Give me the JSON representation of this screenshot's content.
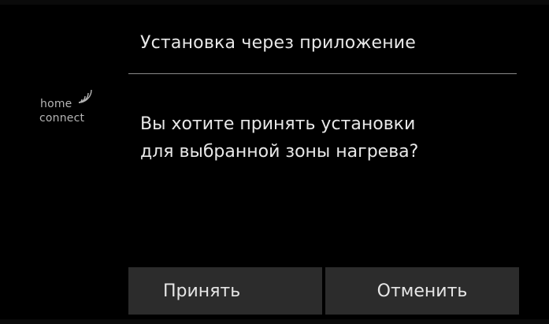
{
  "dialog": {
    "title": "Установка через приложение",
    "message_line1": "Вы хотите принять установки",
    "message_line2": "для выбранной зоны нагрева?"
  },
  "logo": {
    "word_top": "home",
    "word_bottom": "connect",
    "icon": "wifi-signal-icon"
  },
  "buttons": {
    "accept_label": "Принять",
    "cancel_label": "Отменить"
  },
  "colors": {
    "background": "#000000",
    "text": "#e8e8e8",
    "button_bg": "#2c2c2c",
    "divider": "#8a8a8a"
  }
}
